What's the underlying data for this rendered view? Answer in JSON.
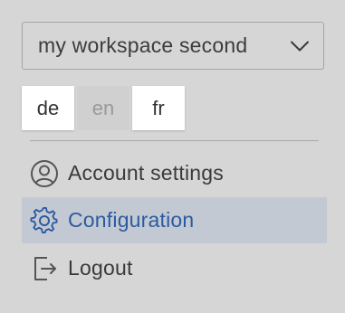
{
  "workspace_select": {
    "value": "my workspace second",
    "icon": "chevron-down-icon"
  },
  "languages": [
    {
      "code": "de",
      "active": false
    },
    {
      "code": "en",
      "active": true
    },
    {
      "code": "fr",
      "active": false
    }
  ],
  "menu": {
    "items": [
      {
        "label": "Account settings",
        "icon": "user-circle-icon",
        "selected": false
      },
      {
        "label": "Configuration",
        "icon": "gear-icon",
        "selected": true
      },
      {
        "label": "Logout",
        "icon": "logout-icon",
        "selected": false
      }
    ]
  },
  "colors": {
    "background": "#d6d6d6",
    "selected_background": "#c3c9d3",
    "accent": "#2c5aa0",
    "text": "#3a3a3a",
    "inactive_language_text": "#9a9a9a"
  }
}
